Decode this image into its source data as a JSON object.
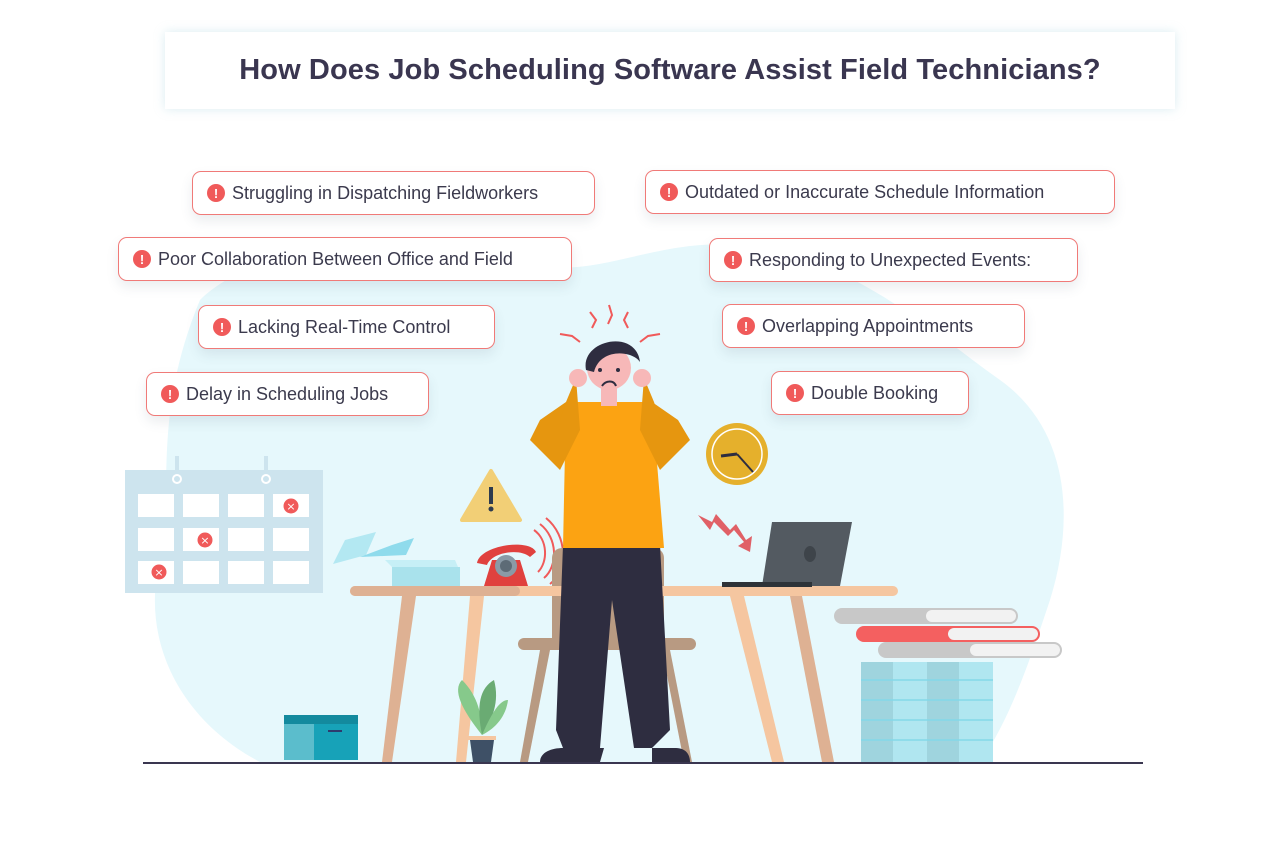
{
  "title": "How Does Job Scheduling Software Assist Field Technicians?",
  "challenges_left": [
    {
      "label": "Struggling in Dispatching Fieldworkers",
      "icon": "exclamation-icon"
    },
    {
      "label": "Poor Collaboration Between Office and Field",
      "icon": "exclamation-icon"
    },
    {
      "label": "Lacking Real-Time Control",
      "icon": "exclamation-icon"
    },
    {
      "label": "Delay in Scheduling Jobs",
      "icon": "exclamation-icon"
    }
  ],
  "challenges_right": [
    {
      "label": "Outdated or Inaccurate Schedule Information",
      "icon": "exclamation-icon"
    },
    {
      "label": "Responding to Unexpected Events:",
      "icon": "exclamation-icon"
    },
    {
      "label": "Overlapping Appointments",
      "icon": "exclamation-icon"
    },
    {
      "label": "Double Booking",
      "icon": "exclamation-icon"
    }
  ],
  "icon_glyph": "!",
  "colors": {
    "title_text": "#3a3650",
    "pill_border": "#f07a78",
    "alert_red": "#f05a5a",
    "blob_bg": "#e6f8fc",
    "shirt": "#fca312",
    "pants": "#2e2d40"
  }
}
